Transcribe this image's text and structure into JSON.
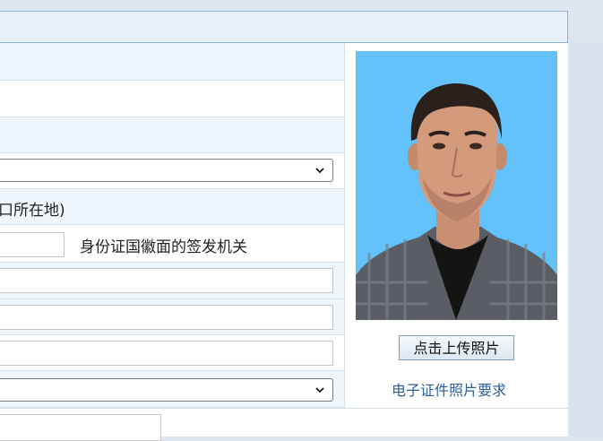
{
  "form": {
    "hukou_hint": "口所在地)",
    "issuing_authority_hint": "身份证国徽面的签发机关"
  },
  "photo_panel": {
    "upload_button": "点击上传照片",
    "requirements_link": "电子证件照片要求"
  },
  "colors": {
    "photo_background": "#63c1fb",
    "link": "#2c5f97",
    "header_border": "#8fb2cf"
  }
}
